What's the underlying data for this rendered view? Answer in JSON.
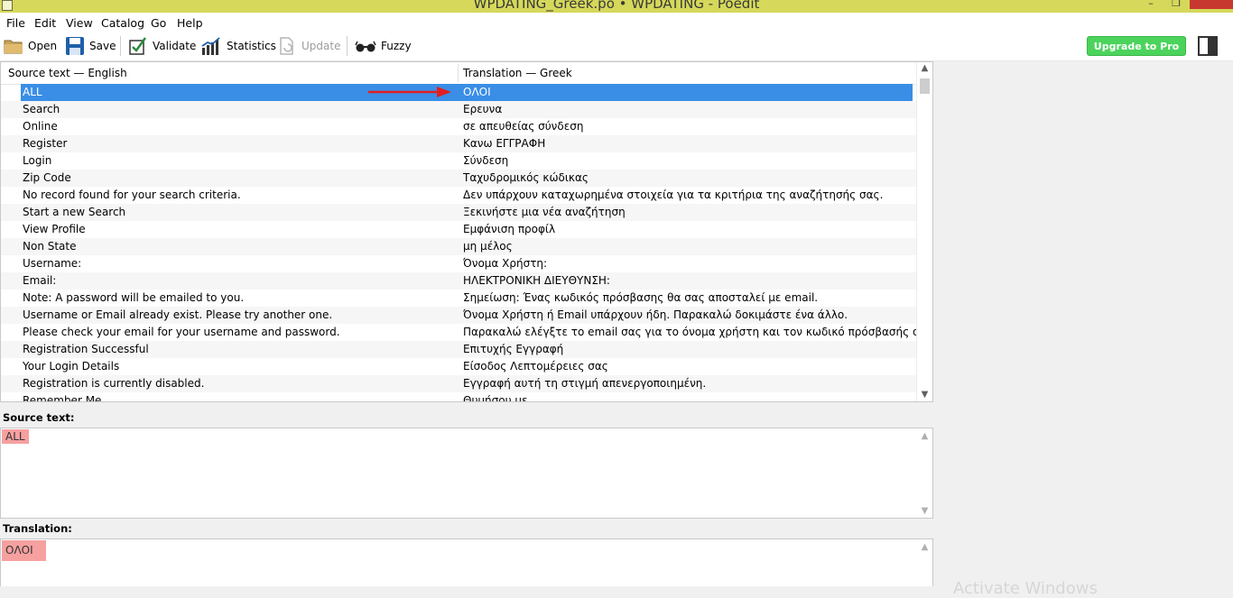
{
  "window": {
    "title": "WPDATING_Greek.po • WPDATING - Poedit",
    "minimize": "–",
    "maximize": "❐",
    "close": ""
  },
  "menu": [
    "File",
    "Edit",
    "View",
    "Catalog",
    "Go",
    "Help"
  ],
  "toolbar": {
    "open": "Open",
    "save": "Save",
    "validate": "Validate",
    "statistics": "Statistics",
    "update": "Update",
    "fuzzy": "Fuzzy",
    "upgrade": "Upgrade to Pro"
  },
  "list": {
    "header_source": "Source text — English",
    "header_translation": "Translation — Greek",
    "rows": [
      {
        "source": "ALL",
        "translation": "ΟΛΟΙ"
      },
      {
        "source": "Search",
        "translation": "Ερευνα"
      },
      {
        "source": "Online",
        "translation": "σε απευθείας σύνδεση"
      },
      {
        "source": "Register",
        "translation": "Κανω ΕΓΓΡΑΦΗ"
      },
      {
        "source": "Login",
        "translation": "Σύνδεση"
      },
      {
        "source": "Zip Code",
        "translation": "Ταχυδρομικός κώδικας"
      },
      {
        "source": "No record found for your search criteria.",
        "translation": "Δεν υπάρχουν καταχωρημένα στοιχεία για τα κριτήρια της αναζήτησής σας."
      },
      {
        "source": "Start a new Search",
        "translation": "Ξεκινήστε μια νέα αναζήτηση"
      },
      {
        "source": "View Profile",
        "translation": "Εμφάνιση προφίλ"
      },
      {
        "source": "Non State",
        "translation": "μη μέλος"
      },
      {
        "source": "Username:",
        "translation": "Όνομα Χρήστη:"
      },
      {
        "source": "Email:",
        "translation": "ΗΛΕΚΤΡΟΝΙΚΗ ΔΙΕΥΘΥΝΣΗ:"
      },
      {
        "source": "Note: A password will be emailed to you.",
        "translation": "Σημείωση: Ένας κωδικός πρόσβασης θα σας αποσταλεί με email."
      },
      {
        "source": "Username or Email already exist. Please try another one.",
        "translation": "Όνομα Χρήστη ή Email υπάρχουν ήδη. Παρακαλώ δοκιμάστε ένα άλλο."
      },
      {
        "source": "Please check your email for your username and password.",
        "translation": "Παρακαλώ ελέγξτε το email σας για το όνομα χρήστη και τον κωδικό πρόσβασής σας."
      },
      {
        "source": "Registration Successful",
        "translation": "Επιτυχής Εγγραφή"
      },
      {
        "source": "Your Login Details",
        "translation": "Είσοδος Λεπτομέρειες σας"
      },
      {
        "source": "Registration is currently disabled.",
        "translation": "Εγγραφή αυτή τη στιγμή απενεργοποιημένη."
      },
      {
        "source": "Remember Me",
        "translation": "Θυμήσου με"
      }
    ]
  },
  "source_panel": {
    "label": "Source text:",
    "value": "ALL"
  },
  "translation_panel": {
    "label": "Translation:",
    "value": "ΟΛΟΙ"
  },
  "watermark": "Activate Windows",
  "colors": {
    "titlebar": "#d5d85a",
    "selection": "#3a8ee6",
    "highlight": "#f6a0a0",
    "upgrade": "#4cd35c",
    "arrow": "#e02020"
  }
}
